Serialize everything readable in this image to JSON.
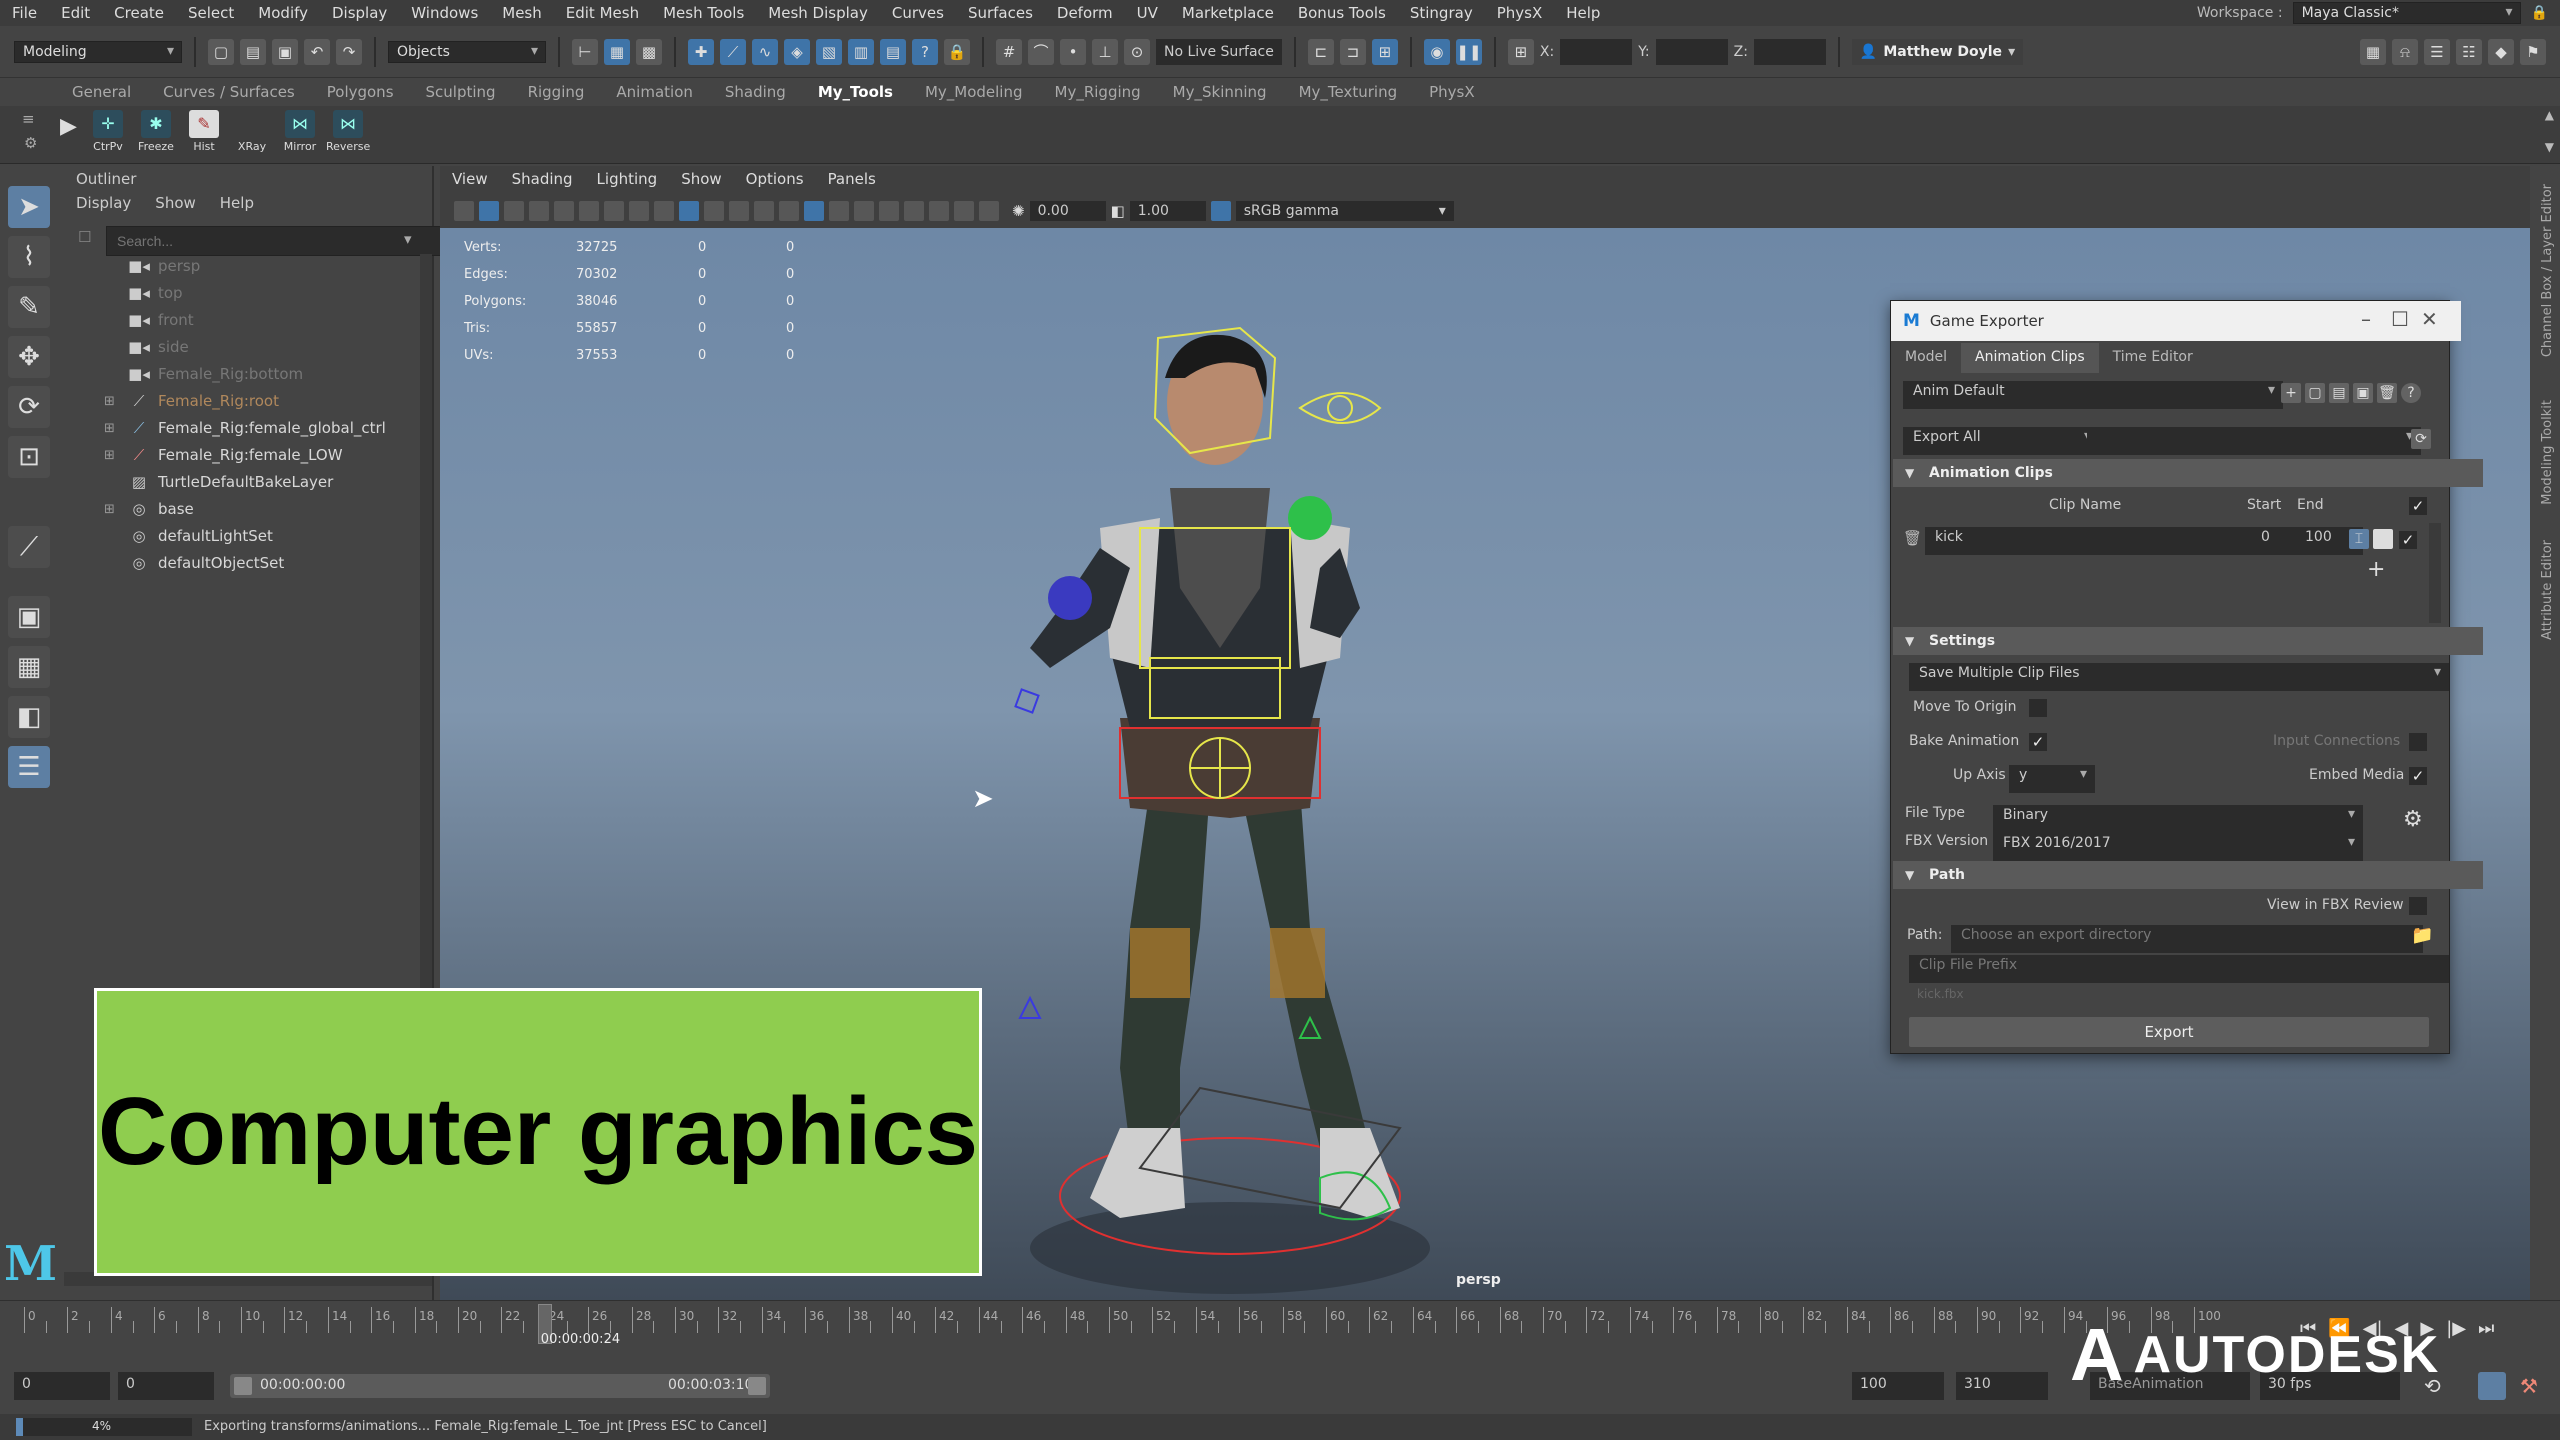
{
  "menubar": {
    "items": [
      "File",
      "Edit",
      "Create",
      "Select",
      "Modify",
      "Display",
      "Windows",
      "Mesh",
      "Edit Mesh",
      "Mesh Tools",
      "Mesh Display",
      "Curves",
      "Surfaces",
      "Deform",
      "UV",
      "Marketplace",
      "Bonus Tools",
      "Stingray",
      "PhysX",
      "Help"
    ],
    "workspace_label": "Workspace :",
    "workspace_value": "Maya Classic*"
  },
  "statusline": {
    "mode": "Modeling",
    "selection_mode": "Objects",
    "live_surface": "No Live Surface",
    "x_label": "X:",
    "y_label": "Y:",
    "z_label": "Z:",
    "user": "Matthew Doyle"
  },
  "shelf": {
    "tabs": [
      "General",
      "Curves / Surfaces",
      "Polygons",
      "Sculpting",
      "Rigging",
      "Animation",
      "Shading",
      "My_Tools",
      "My_Modeling",
      "My_Rigging",
      "My_Skinning",
      "My_Texturing",
      "PhysX"
    ],
    "active_tab": "My_Tools",
    "buttons": [
      "CtrPv",
      "Freeze",
      "Hist",
      "XRay",
      "Mirror",
      "Reverse"
    ]
  },
  "outliner": {
    "title": "Outliner",
    "menu": [
      "Display",
      "Show",
      "Help"
    ],
    "search_placeholder": "Search...",
    "rows": [
      {
        "label": "persp",
        "style": "dim"
      },
      {
        "label": "top",
        "style": "dim"
      },
      {
        "label": "front",
        "style": "dim"
      },
      {
        "label": "side",
        "style": "dim"
      },
      {
        "label": "Female_Rig:bottom",
        "style": "dim"
      },
      {
        "label": "Female_Rig:root",
        "style": "orange"
      },
      {
        "label": "Female_Rig:female_global_ctrl",
        "style": "normal"
      },
      {
        "label": "Female_Rig:female_LOW",
        "style": "normal"
      },
      {
        "label": "TurtleDefaultBakeLayer",
        "style": "normal"
      },
      {
        "label": "base",
        "style": "normal"
      },
      {
        "label": "defaultLightSet",
        "style": "normal"
      },
      {
        "label": "defaultObjectSet",
        "style": "normal"
      }
    ]
  },
  "viewport": {
    "menu": [
      "View",
      "Shading",
      "Lighting",
      "Show",
      "Options",
      "Panels"
    ],
    "exposure": "0.00",
    "gamma": "1.00",
    "color_space": "sRGB gamma",
    "camera": "persp",
    "hud": [
      {
        "label": "Verts:",
        "value": "32725",
        "a": "0",
        "b": "0"
      },
      {
        "label": "Edges:",
        "value": "70302",
        "a": "0",
        "b": "0"
      },
      {
        "label": "Polygons:",
        "value": "38046",
        "a": "0",
        "b": "0"
      },
      {
        "label": "Tris:",
        "value": "55857",
        "a": "0",
        "b": "0"
      },
      {
        "label": "UVs:",
        "value": "37553",
        "a": "0",
        "b": "0"
      }
    ]
  },
  "game_exporter": {
    "title": "Game Exporter",
    "tabs": [
      "Model",
      "Animation Clips",
      "Time Editor"
    ],
    "active_tab": "Animation Clips",
    "preset": "Anim Default",
    "export_mode": "Export All",
    "clips_section": "Animation Clips",
    "col_clip_name": "Clip Name",
    "col_start": "Start",
    "col_end": "End",
    "clip": {
      "name": "kick",
      "start": "0",
      "end": "100"
    },
    "settings_section": "Settings",
    "save_mode": "Save Multiple Clip Files",
    "move_to_origin": "Move To Origin",
    "bake_animation": "Bake Animation",
    "input_connections": "Input Connections",
    "up_axis_label": "Up Axis",
    "up_axis_value": "y",
    "embed_media": "Embed Media",
    "file_type_label": "File Type",
    "file_type_value": "Binary",
    "fbx_version_label": "FBX Version",
    "fbx_version_value": "FBX 2016/2017",
    "path_section": "Path",
    "view_in_fbx": "View in FBX Review",
    "path_label": "Path:",
    "path_placeholder": "Choose an export directory",
    "prefix_placeholder": "Clip File Prefix",
    "prefix_example": "kick.fbx",
    "export_button": "Export"
  },
  "side_labels": [
    "Channel Box / Layer Editor",
    "Modeling Toolkit",
    "Attribute Editor"
  ],
  "timeslider": {
    "tick_labels": [
      "0",
      "2",
      "4",
      "6",
      "8",
      "10",
      "12",
      "14",
      "16",
      "18",
      "20",
      "22",
      "24",
      "26",
      "28",
      "30",
      "32",
      "34",
      "36",
      "38",
      "40",
      "42",
      "44",
      "46",
      "48",
      "50",
      "52",
      "54",
      "56",
      "58",
      "60",
      "62",
      "64",
      "66",
      "68",
      "70",
      "72",
      "74",
      "76",
      "78",
      "80",
      "82",
      "84",
      "86",
      "88",
      "90",
      "92",
      "94",
      "96",
      "98",
      "100"
    ],
    "current_time": "00:00:00:24",
    "current_frame": 24
  },
  "rangeslider": {
    "start_field": "0",
    "start_field2": "0",
    "range_start_time": "00:00:00:00",
    "range_end_time": "00:00:03:10",
    "end_field": "100",
    "end_field2": "310",
    "anim_layer": "BaseAnimation",
    "fps": "30 fps"
  },
  "helpline": {
    "progress_percent": 4,
    "progress_text": "4%",
    "message": "Exporting transforms/animations... Female_Rig:female_L_Toe_jnt [Press ESC to Cancel]"
  },
  "banner": {
    "text": "Computer graphics",
    "color": "#8fcd4f"
  },
  "brand": {
    "autodesk": "AUTODESK"
  }
}
